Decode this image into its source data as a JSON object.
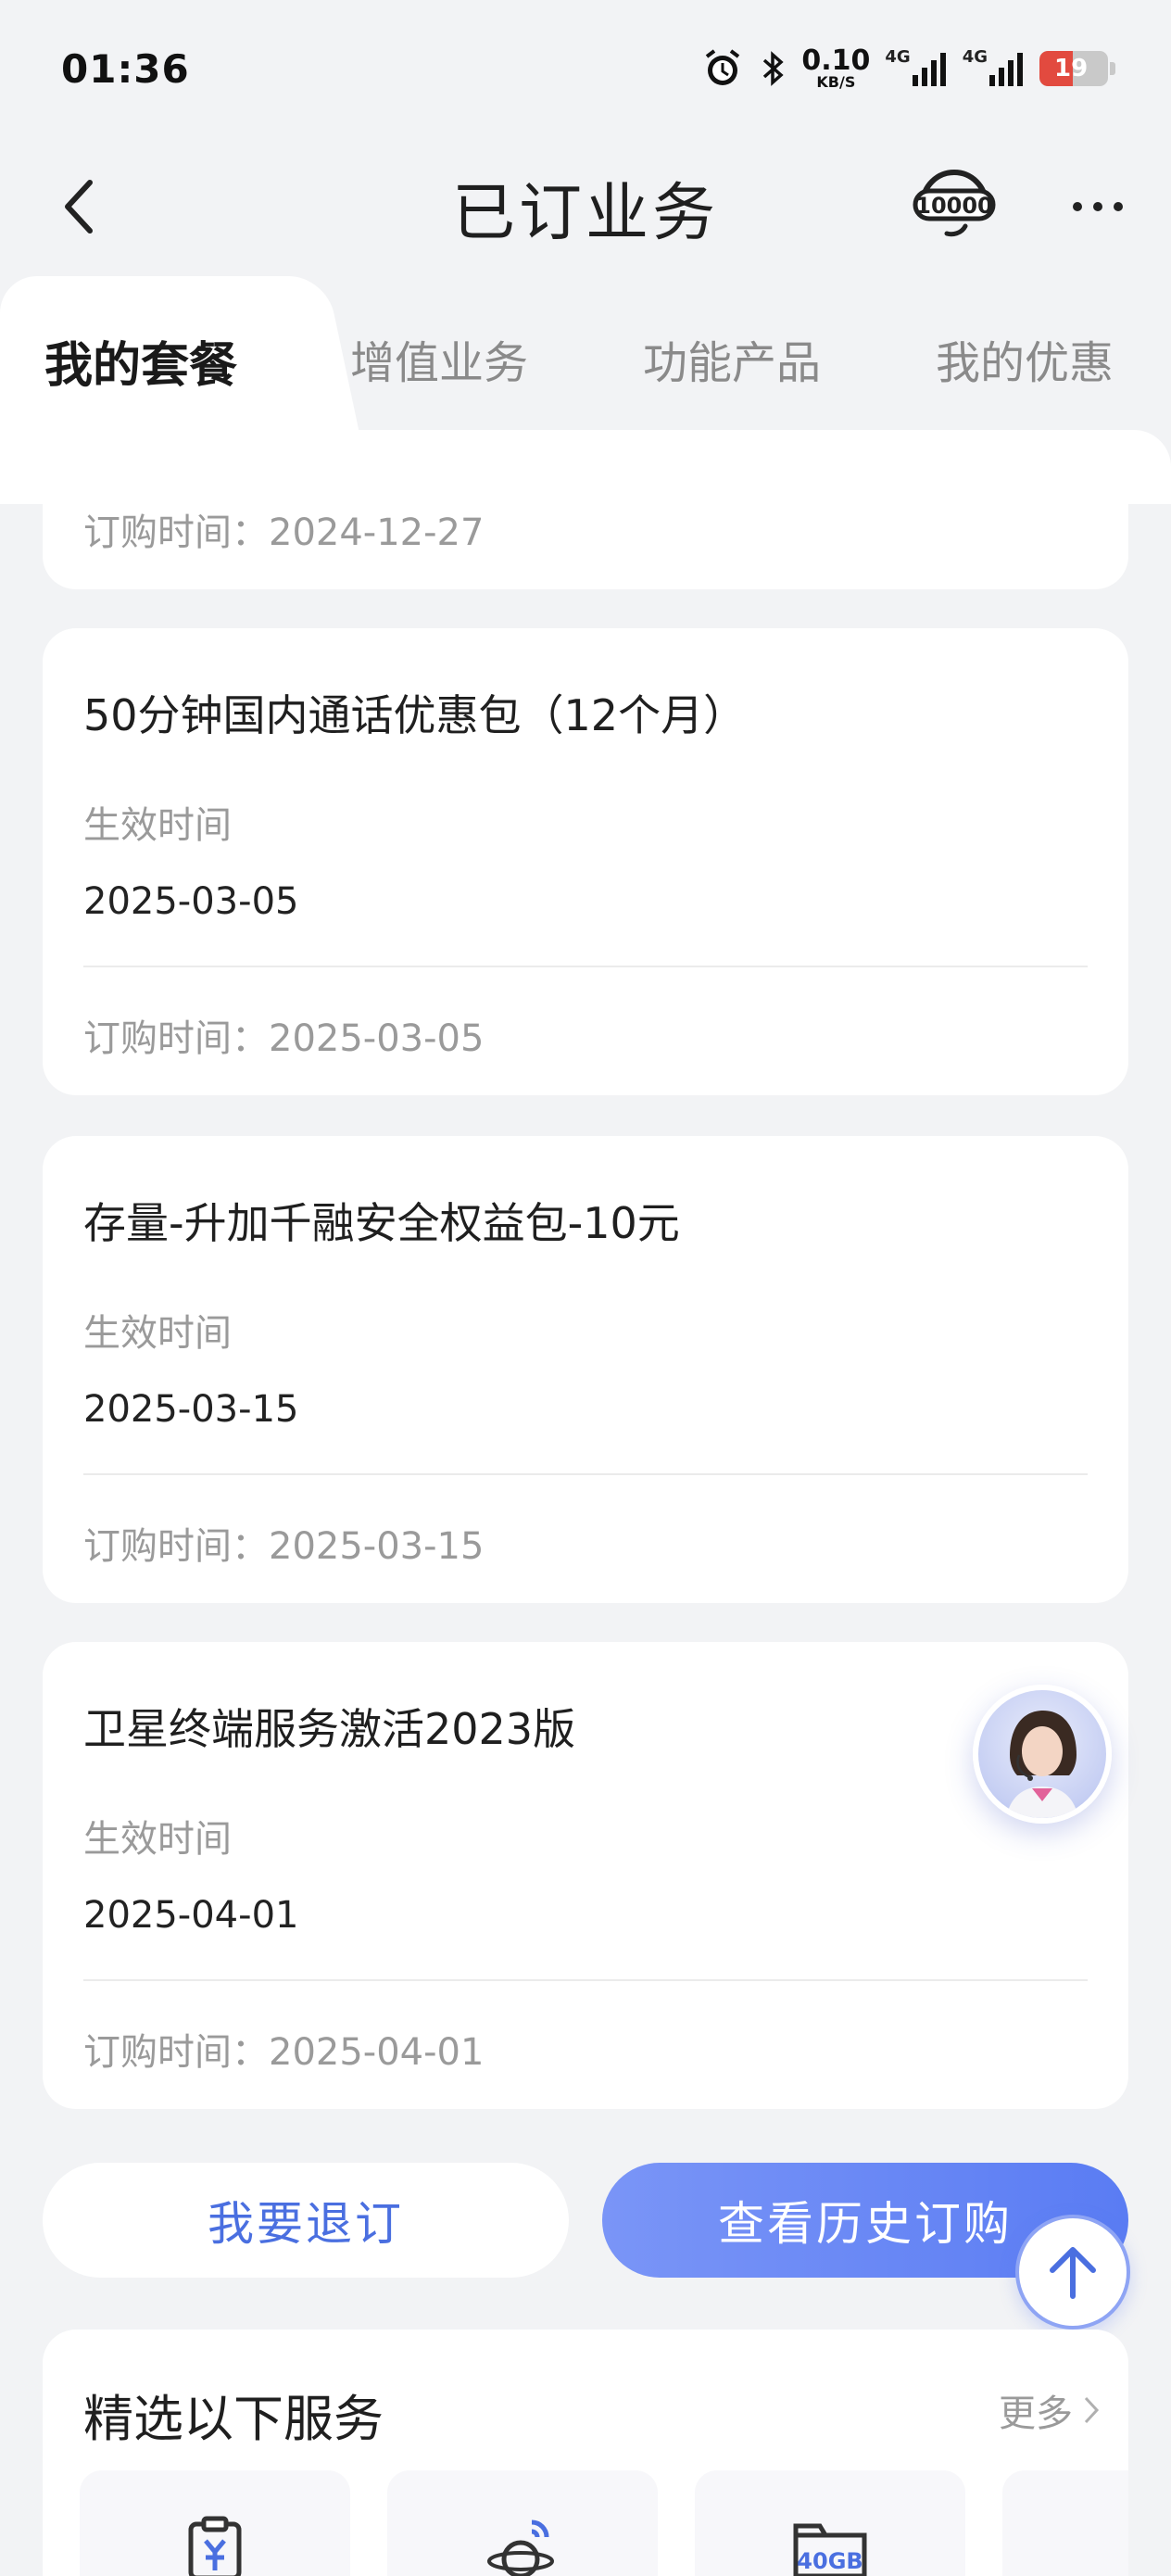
{
  "status_bar": {
    "time": "01:36",
    "net_speed": "0.10",
    "net_unit": "KB/S",
    "sim1_type": "4G",
    "sim2_type": "4G",
    "battery_level": "19",
    "battery_color": "#e24a3f"
  },
  "header": {
    "title": "已订业务",
    "back_icon": "chevron-left-icon",
    "cs_icon": "headset-10000-icon",
    "more_icon": "more-dots-icon"
  },
  "tabs": [
    {
      "label": "我的套餐",
      "active": true
    },
    {
      "label": "增值业务",
      "active": false
    },
    {
      "label": "功能产品",
      "active": false
    },
    {
      "label": "我的优惠",
      "active": false
    }
  ],
  "partial_card": {
    "order_line": "订购时间：2024-12-27"
  },
  "cards": [
    {
      "title": "50分钟国内通话优惠包（12个月）",
      "effective_label": "生效时间",
      "effective_date": "2025-03-05",
      "order_line": "订购时间：2025-03-05"
    },
    {
      "title": "存量-升加千融安全权益包-10元",
      "effective_label": "生效时间",
      "effective_date": "2025-03-15",
      "order_line": "订购时间：2025-03-15"
    },
    {
      "title": "卫星终端服务激活2023版",
      "effective_label": "生效时间",
      "effective_date": "2025-04-01",
      "order_line": "订购时间：2025-04-01"
    }
  ],
  "actions": {
    "unsubscribe": "我要退订",
    "history": "查看历史订购"
  },
  "services": {
    "title": "精选以下服务",
    "more": "更多",
    "items": [
      {
        "icon": "bill-clipboard-icon"
      },
      {
        "icon": "planet-signal-icon"
      },
      {
        "icon": "data-folder-icon",
        "badge": "40GB"
      },
      {
        "icon": "partial-service-icon"
      }
    ]
  },
  "colors": {
    "accent": "#5a7cf3",
    "accent_text": "#4a6fe0",
    "background": "#f2f3f5"
  }
}
